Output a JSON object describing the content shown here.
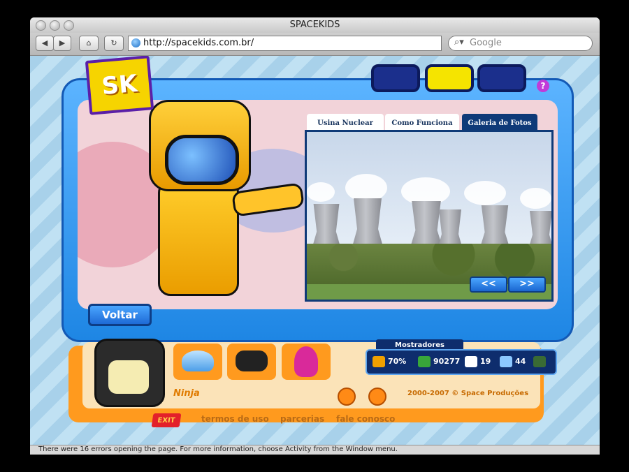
{
  "window": {
    "title": "SPACEKIDS"
  },
  "toolbar": {
    "url": "http://spacekids.com.br/",
    "search_placeholder": "Google"
  },
  "page": {
    "tabs": [
      "Usina Nuclear",
      "Como Funciona",
      "Galeria de Fotos"
    ],
    "active_tab": "Galeria de Fotos",
    "prev_label": "<<",
    "next_label": ">>",
    "back_label": "Voltar",
    "character_name": "Ninja",
    "copyright": "2000-2007 © Space Produções",
    "exit_label": "EXIT",
    "footer_links": [
      "termos de uso",
      "parcerias",
      "fale conosco"
    ],
    "mostradores": {
      "title": "Mostradores",
      "stats": [
        {
          "icon": "energy-gauge-icon",
          "value": "70%"
        },
        {
          "icon": "money-icon",
          "value": "90277"
        },
        {
          "icon": "mail-icon",
          "value": "19"
        },
        {
          "icon": "chat-icon",
          "value": "44"
        },
        {
          "icon": "screen-icon",
          "value": ""
        }
      ]
    },
    "help_label": "?"
  },
  "statusbar": {
    "text": "There were 16 errors opening the page. For more information, choose Activity from the Window menu."
  }
}
